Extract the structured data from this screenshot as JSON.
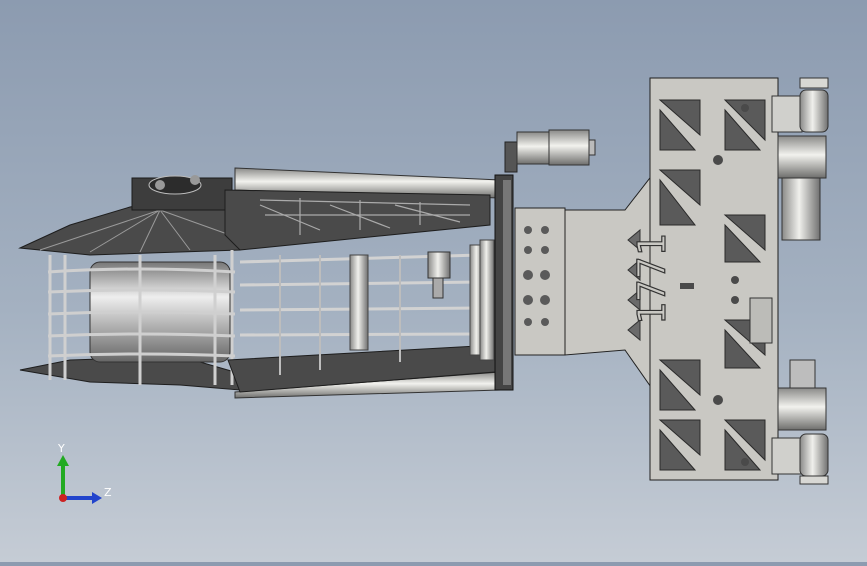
{
  "viewport": {
    "part_marking": "1771",
    "colors": {
      "background_top": "#8c9bb0",
      "background_bottom": "#c5ccd5",
      "frame_light": "#c9c8c3",
      "frame_dark": "#3a3a3a",
      "metal": "#d8d8d4",
      "edge": "#222222"
    }
  },
  "triad": {
    "y_label": "Y",
    "z_label": "Z",
    "colors": {
      "y": "#22aa22",
      "z": "#2244cc",
      "origin": "#cc2222"
    }
  }
}
